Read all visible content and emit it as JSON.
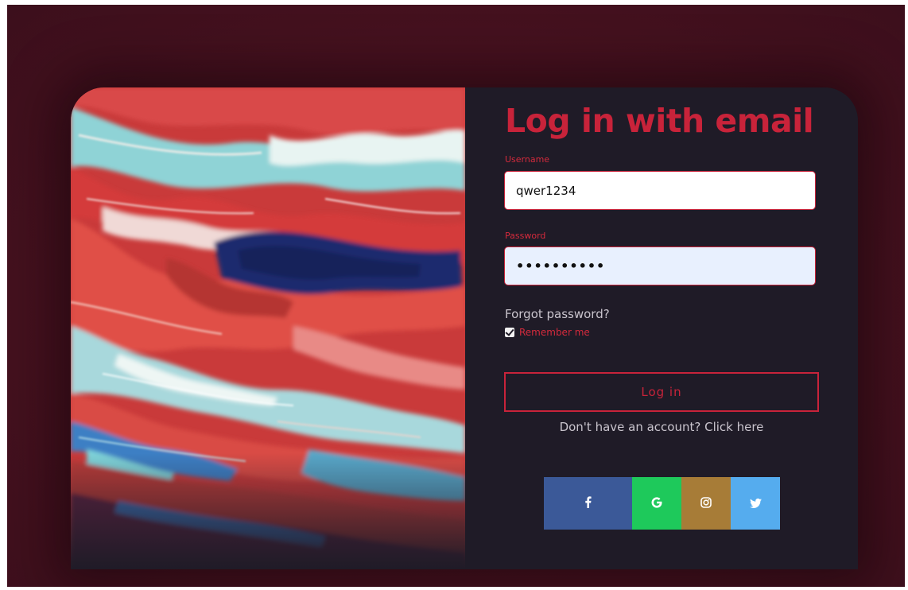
{
  "form": {
    "title": "Log in with email",
    "username_label": "Username",
    "username_value": "qwer1234",
    "password_label": "Password",
    "password_value": "••••••••••",
    "forgot_link": "Forgot password?",
    "remember_label": "Remember me",
    "remember_checked": true,
    "login_button": "Log in",
    "signup_link": "Don't have an account? Click here"
  },
  "social": [
    {
      "icon": "facebook-icon",
      "color": "#3b5998"
    },
    {
      "icon": "google-icon",
      "color": "#1ec95b"
    },
    {
      "icon": "instagram-icon",
      "color": "#a77c37"
    },
    {
      "icon": "twitter-icon",
      "color": "#55acee"
    }
  ],
  "colors": {
    "accent": "#c8233a",
    "panel": "#1f1b27",
    "backdrop": "#4a1220"
  }
}
